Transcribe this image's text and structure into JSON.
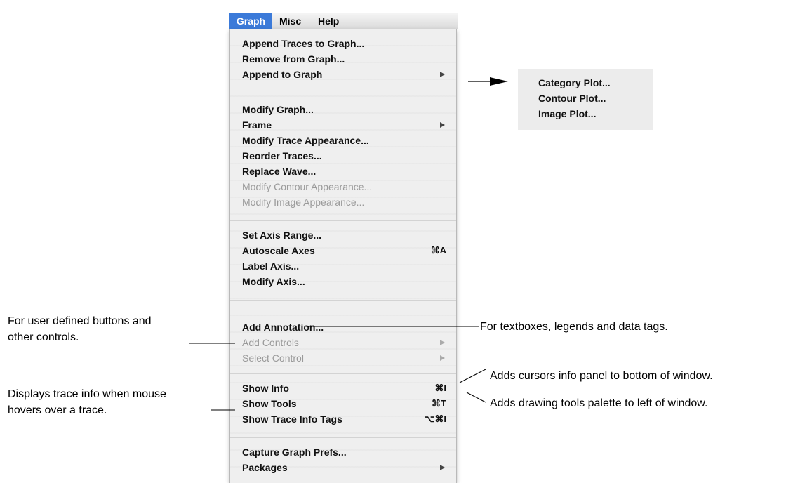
{
  "menubar": {
    "items": [
      "Graph",
      "Misc",
      "Help"
    ]
  },
  "menu": {
    "items": [
      {
        "label": "Append Traces to Graph...",
        "enabled": true
      },
      {
        "label": "Remove from Graph...",
        "enabled": true
      },
      {
        "label": "Append to Graph",
        "enabled": true,
        "submenu": true
      },
      {
        "label": "Modify Graph...",
        "enabled": true
      },
      {
        "label": "Frame",
        "enabled": true,
        "submenu": true
      },
      {
        "label": "Modify Trace Appearance...",
        "enabled": true
      },
      {
        "label": "Reorder Traces...",
        "enabled": true
      },
      {
        "label": "Replace Wave...",
        "enabled": true
      },
      {
        "label": "Modify Contour Appearance...",
        "enabled": false
      },
      {
        "label": "Modify Image Appearance...",
        "enabled": false
      },
      {
        "label": "Set Axis Range...",
        "enabled": true
      },
      {
        "label": "Autoscale Axes",
        "enabled": true,
        "shortcut": "⌘A"
      },
      {
        "label": "Label Axis...",
        "enabled": true
      },
      {
        "label": "Modify Axis...",
        "enabled": true
      },
      {
        "label": "Add Annotation...",
        "enabled": true
      },
      {
        "label": "Add Controls",
        "enabled": false,
        "submenu": true
      },
      {
        "label": "Select Control",
        "enabled": false,
        "submenu": true
      },
      {
        "label": "Show Info",
        "enabled": true,
        "shortcut": "⌘I"
      },
      {
        "label": "Show Tools",
        "enabled": true,
        "shortcut": "⌘T"
      },
      {
        "label": "Show Trace Info Tags",
        "enabled": true,
        "shortcut": "⌥⌘I"
      },
      {
        "label": "Capture Graph Prefs...",
        "enabled": true
      },
      {
        "label": "Packages",
        "enabled": true,
        "submenu": true
      }
    ]
  },
  "submenu": {
    "items": [
      "Category Plot...",
      "Contour Plot...",
      "Image Plot..."
    ]
  },
  "annotations": {
    "user_buttons": [
      "For user defined buttons and",
      "other controls."
    ],
    "textboxes": "For textboxes, legends and data tags.",
    "cursors": "Adds cursors info panel to bottom of window.",
    "trace_info": [
      "Displays trace info when mouse",
      "hovers over a trace."
    ],
    "drawing_tools": "Adds drawing tools palette to left of window."
  },
  "colors": {
    "menu_highlight": "#3b7ad9",
    "menu_background": "#efefef",
    "disabled_text": "#9a9a9a"
  }
}
